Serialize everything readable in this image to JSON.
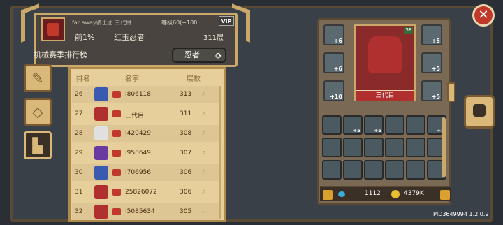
{
  "banner": {
    "guild": "far away骑士团",
    "player": "三代目",
    "level": "等级60(+100",
    "rank_pct": "前1%",
    "title": "红玉忍者",
    "floor": "311层"
  },
  "season": {
    "title": "机械赛季排行榜",
    "class": "忍者"
  },
  "list": {
    "headers": [
      "排名",
      "名字",
      "层数"
    ],
    "rows": [
      {
        "rank": "26",
        "name": "I806118",
        "floor": "313"
      },
      {
        "rank": "27",
        "name": "三代目",
        "floor": "311"
      },
      {
        "rank": "28",
        "name": "I420429",
        "floor": "308"
      },
      {
        "rank": "29",
        "name": "I958649",
        "floor": "307"
      },
      {
        "rank": "30",
        "name": "I706956",
        "floor": "306"
      },
      {
        "rank": "31",
        "name": "25826072",
        "floor": "306"
      },
      {
        "rank": "32",
        "name": "I5085634",
        "floor": "305"
      }
    ]
  },
  "character": {
    "name": "三代目",
    "level": "58"
  },
  "equip_plus": [
    "+6",
    "+6",
    "+10",
    "+5",
    "+5",
    "+5"
  ],
  "inventory_plus": [
    "+5",
    "+5",
    "+5"
  ],
  "currency": {
    "gems": "1112",
    "coins": "4379K"
  },
  "player_id": "PID3649994 1.2.0.9",
  "colors": {
    "accent": "#c9a86a",
    "close": "#c0392b"
  }
}
